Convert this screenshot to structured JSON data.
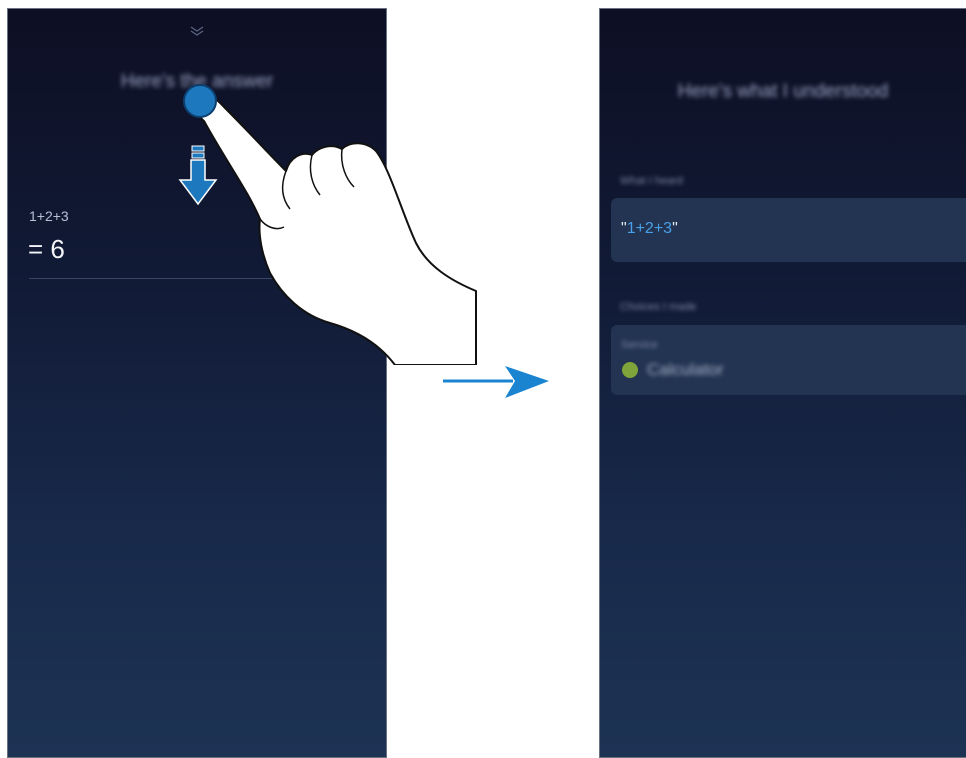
{
  "left_screen": {
    "title": "Here's the answer",
    "question": "1+2+3",
    "answer": "= 6"
  },
  "right_screen": {
    "title": "Here's what I understood",
    "heard_label": "What I heard",
    "heard_text": "1+2+3",
    "quote_open": "\"",
    "quote_close": "\"",
    "choices_label": "Choices I made",
    "service_label": "Service",
    "service_name": "Calculator"
  },
  "icons": {
    "chevron": "double-chevron-down-icon",
    "tap": "tap-indicator-icon",
    "down_arrow": "swipe-down-arrow-icon",
    "hand": "pointing-hand-icon",
    "transition": "right-arrow-icon",
    "service": "calculator-app-icon"
  },
  "colors": {
    "accent": "#4aa0e8",
    "tap": "#1e78be",
    "calculator_icon": "#7fa43a",
    "transition_arrow": "#1a84d0"
  }
}
